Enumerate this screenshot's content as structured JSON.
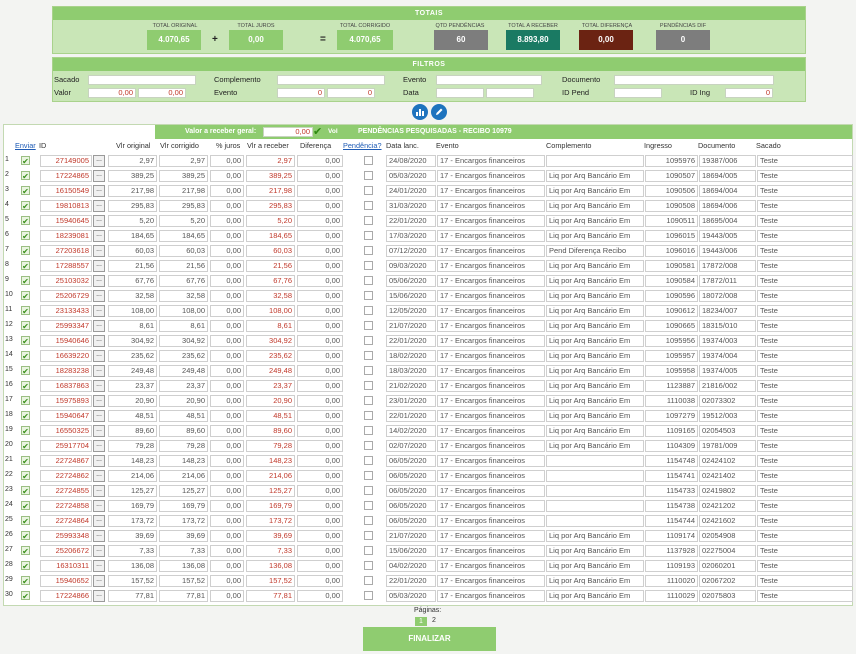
{
  "totals": {
    "title": "TOTAIS",
    "total_original_label": "TOTAL ORIGINAL",
    "total_original": "4.070,65",
    "total_juros_label": "TOTAL JUROS",
    "total_juros": "0,00",
    "total_corrigido_label": "TOTAL CORRIGIDO",
    "total_corrigido": "4.070,65",
    "qtd_pendencias_label": "QTD PENDÊNCIAS",
    "qtd_pendencias": "60",
    "total_receber_label": "TOTAL A RECEBER",
    "total_receber": "8.893,80",
    "total_diferenca_label": "TOTAL DIFERENÇA",
    "total_diferenca": "0,00",
    "pendencias_dif_label": "PENDÊNCIAS DIF",
    "pendencias_dif": "0",
    "plus": "+",
    "equals": "=",
    "colors": {
      "green_box": "#8fcc70",
      "gray_box": "#7d7d7d",
      "teal_box": "#1a7a63",
      "brown_box": "#6b2312"
    }
  },
  "filters": {
    "title": "FILTROS",
    "sacado_label": "Sacado",
    "complemento_label": "Complemento",
    "evento_label": "Evento",
    "documento_label": "Documento",
    "valor_label": "Valor",
    "valor_from": "0,00",
    "valor_to": "0,00",
    "evento2_label": "Evento",
    "evento_from": "0",
    "evento_to": "0",
    "data_label": "Data",
    "id_pend_label": "ID Pend",
    "id_ing_label": "ID Ing",
    "id_ing": "0"
  },
  "actions": {
    "chart_icon": "bar-chart-icon",
    "edit_icon": "pencil-icon"
  },
  "table": {
    "valor_receber_label": "Valor a receber geral:",
    "valor_receber": "0,00",
    "vol_label": "Vol",
    "pendencias_title": "PENDÊNCIAS PESQUISADAS - RECIBO 10979",
    "headers": {
      "enviar": "Enviar",
      "id": "ID",
      "vlr_original": "Vlr original",
      "vlr_corrigido": "Vlr corrigido",
      "juros": "% juros",
      "vlr_receber": "Vlr a receber",
      "diferenca": "Diferença",
      "pendencia": "Pendência?",
      "data_lanc": "Data lanc.",
      "evento": "Evento",
      "complemento": "Complemento",
      "ingresso": "Ingresso",
      "documento": "Documento",
      "sacado": "Sacado"
    },
    "dots_label": "...",
    "rows": [
      {
        "n": "1",
        "id": "27149005",
        "orig": "2,97",
        "corr": "2,97",
        "juros": "0,00",
        "receber": "2,97",
        "dif": "0,00",
        "data": "24/08/2020",
        "evento": "17 - Encargos financeiros",
        "comp": "",
        "ing": "1095976",
        "doc": "19387/006",
        "sacado": "Teste"
      },
      {
        "n": "2",
        "id": "17224865",
        "orig": "389,25",
        "corr": "389,25",
        "juros": "0,00",
        "receber": "389,25",
        "dif": "0,00",
        "data": "05/03/2020",
        "evento": "17 - Encargos financeiros",
        "comp": "Liq por Arq Bancário Em",
        "ing": "1090507",
        "doc": "18694/005",
        "sacado": "Teste"
      },
      {
        "n": "3",
        "id": "16150549",
        "orig": "217,98",
        "corr": "217,98",
        "juros": "0,00",
        "receber": "217,98",
        "dif": "0,00",
        "data": "24/01/2020",
        "evento": "17 - Encargos financeiros",
        "comp": "Liq por Arq Bancário Em",
        "ing": "1090506",
        "doc": "18694/004",
        "sacado": "Teste"
      },
      {
        "n": "4",
        "id": "19810813",
        "orig": "295,83",
        "corr": "295,83",
        "juros": "0,00",
        "receber": "295,83",
        "dif": "0,00",
        "data": "31/03/2020",
        "evento": "17 - Encargos financeiros",
        "comp": "Liq por Arq Bancário Em",
        "ing": "1090508",
        "doc": "18694/006",
        "sacado": "Teste"
      },
      {
        "n": "5",
        "id": "15940645",
        "orig": "5,20",
        "corr": "5,20",
        "juros": "0,00",
        "receber": "5,20",
        "dif": "0,00",
        "data": "22/01/2020",
        "evento": "17 - Encargos financeiros",
        "comp": "Liq por Arq Bancário Em",
        "ing": "1090511",
        "doc": "18695/004",
        "sacado": "Teste"
      },
      {
        "n": "6",
        "id": "18239081",
        "orig": "184,65",
        "corr": "184,65",
        "juros": "0,00",
        "receber": "184,65",
        "dif": "0,00",
        "data": "17/03/2020",
        "evento": "17 - Encargos financeiros",
        "comp": "Liq por Arq Bancário Em",
        "ing": "1096015",
        "doc": "19443/005",
        "sacado": "Teste"
      },
      {
        "n": "7",
        "id": "27203618",
        "orig": "60,03",
        "corr": "60,03",
        "juros": "0,00",
        "receber": "60,03",
        "dif": "0,00",
        "data": "07/12/2020",
        "evento": "17 - Encargos financeiros",
        "comp": "Pend Diferença Recibo",
        "ing": "1096016",
        "doc": "19443/006",
        "sacado": "Teste"
      },
      {
        "n": "8",
        "id": "17288557",
        "orig": "21,56",
        "corr": "21,56",
        "juros": "0,00",
        "receber": "21,56",
        "dif": "0,00",
        "data": "09/03/2020",
        "evento": "17 - Encargos financeiros",
        "comp": "Liq por Arq Bancário Em",
        "ing": "1090581",
        "doc": "17872/008",
        "sacado": "Teste"
      },
      {
        "n": "9",
        "id": "25103032",
        "orig": "67,76",
        "corr": "67,76",
        "juros": "0,00",
        "receber": "67,76",
        "dif": "0,00",
        "data": "05/06/2020",
        "evento": "17 - Encargos financeiros",
        "comp": "Liq por Arq Bancário Em",
        "ing": "1090584",
        "doc": "17872/011",
        "sacado": "Teste"
      },
      {
        "n": "10",
        "id": "25206729",
        "orig": "32,58",
        "corr": "32,58",
        "juros": "0,00",
        "receber": "32,58",
        "dif": "0,00",
        "data": "15/06/2020",
        "evento": "17 - Encargos financeiros",
        "comp": "Liq por Arq Bancário Em",
        "ing": "1090596",
        "doc": "18072/008",
        "sacado": "Teste"
      },
      {
        "n": "11",
        "id": "23133433",
        "orig": "108,00",
        "corr": "108,00",
        "juros": "0,00",
        "receber": "108,00",
        "dif": "0,00",
        "data": "12/05/2020",
        "evento": "17 - Encargos financeiros",
        "comp": "Liq por Arq Bancário Em",
        "ing": "1090612",
        "doc": "18234/007",
        "sacado": "Teste"
      },
      {
        "n": "12",
        "id": "25993347",
        "orig": "8,61",
        "corr": "8,61",
        "juros": "0,00",
        "receber": "8,61",
        "dif": "0,00",
        "data": "21/07/2020",
        "evento": "17 - Encargos financeiros",
        "comp": "Liq por Arq Bancário Em",
        "ing": "1090665",
        "doc": "18315/010",
        "sacado": "Teste"
      },
      {
        "n": "13",
        "id": "15940646",
        "orig": "304,92",
        "corr": "304,92",
        "juros": "0,00",
        "receber": "304,92",
        "dif": "0,00",
        "data": "22/01/2020",
        "evento": "17 - Encargos financeiros",
        "comp": "Liq por Arq Bancário Em",
        "ing": "1095956",
        "doc": "19374/003",
        "sacado": "Teste"
      },
      {
        "n": "14",
        "id": "16639220",
        "orig": "235,62",
        "corr": "235,62",
        "juros": "0,00",
        "receber": "235,62",
        "dif": "0,00",
        "data": "18/02/2020",
        "evento": "17 - Encargos financeiros",
        "comp": "Liq por Arq Bancário Em",
        "ing": "1095957",
        "doc": "19374/004",
        "sacado": "Teste"
      },
      {
        "n": "15",
        "id": "18283238",
        "orig": "249,48",
        "corr": "249,48",
        "juros": "0,00",
        "receber": "249,48",
        "dif": "0,00",
        "data": "18/03/2020",
        "evento": "17 - Encargos financeiros",
        "comp": "Liq por Arq Bancário Em",
        "ing": "1095958",
        "doc": "19374/005",
        "sacado": "Teste"
      },
      {
        "n": "16",
        "id": "16837863",
        "orig": "23,37",
        "corr": "23,37",
        "juros": "0,00",
        "receber": "23,37",
        "dif": "0,00",
        "data": "21/02/2020",
        "evento": "17 - Encargos financeiros",
        "comp": "Liq por Arq Bancário Em",
        "ing": "1123887",
        "doc": "21816/002",
        "sacado": "Teste"
      },
      {
        "n": "17",
        "id": "15975893",
        "orig": "20,90",
        "corr": "20,90",
        "juros": "0,00",
        "receber": "20,90",
        "dif": "0,00",
        "data": "23/01/2020",
        "evento": "17 - Encargos financeiros",
        "comp": "Liq por Arq Bancário Em",
        "ing": "1110038",
        "doc": "02073302",
        "sacado": "Teste"
      },
      {
        "n": "18",
        "id": "15940647",
        "orig": "48,51",
        "corr": "48,51",
        "juros": "0,00",
        "receber": "48,51",
        "dif": "0,00",
        "data": "22/01/2020",
        "evento": "17 - Encargos financeiros",
        "comp": "Liq por Arq Bancário Em",
        "ing": "1097279",
        "doc": "19512/003",
        "sacado": "Teste"
      },
      {
        "n": "19",
        "id": "16550325",
        "orig": "89,60",
        "corr": "89,60",
        "juros": "0,00",
        "receber": "89,60",
        "dif": "0,00",
        "data": "14/02/2020",
        "evento": "17 - Encargos financeiros",
        "comp": "Liq por Arq Bancário Em",
        "ing": "1109165",
        "doc": "02054503",
        "sacado": "Teste"
      },
      {
        "n": "20",
        "id": "25917704",
        "orig": "79,28",
        "corr": "79,28",
        "juros": "0,00",
        "receber": "79,28",
        "dif": "0,00",
        "data": "02/07/2020",
        "evento": "17 - Encargos financeiros",
        "comp": "Liq por Arq Bancário Em",
        "ing": "1104309",
        "doc": "19781/009",
        "sacado": "Teste"
      },
      {
        "n": "21",
        "id": "22724867",
        "orig": "148,23",
        "corr": "148,23",
        "juros": "0,00",
        "receber": "148,23",
        "dif": "0,00",
        "data": "06/05/2020",
        "evento": "17 - Encargos financeiros",
        "comp": "",
        "ing": "1154748",
        "doc": "02424102",
        "sacado": "Teste"
      },
      {
        "n": "22",
        "id": "22724862",
        "orig": "214,06",
        "corr": "214,06",
        "juros": "0,00",
        "receber": "214,06",
        "dif": "0,00",
        "data": "06/05/2020",
        "evento": "17 - Encargos financeiros",
        "comp": "",
        "ing": "1154741",
        "doc": "02421402",
        "sacado": "Teste"
      },
      {
        "n": "23",
        "id": "22724855",
        "orig": "125,27",
        "corr": "125,27",
        "juros": "0,00",
        "receber": "125,27",
        "dif": "0,00",
        "data": "06/05/2020",
        "evento": "17 - Encargos financeiros",
        "comp": "",
        "ing": "1154733",
        "doc": "02419802",
        "sacado": "Teste"
      },
      {
        "n": "24",
        "id": "22724858",
        "orig": "169,79",
        "corr": "169,79",
        "juros": "0,00",
        "receber": "169,79",
        "dif": "0,00",
        "data": "06/05/2020",
        "evento": "17 - Encargos financeiros",
        "comp": "",
        "ing": "1154738",
        "doc": "02421202",
        "sacado": "Teste"
      },
      {
        "n": "25",
        "id": "22724864",
        "orig": "173,72",
        "corr": "173,72",
        "juros": "0,00",
        "receber": "173,72",
        "dif": "0,00",
        "data": "06/05/2020",
        "evento": "17 - Encargos financeiros",
        "comp": "",
        "ing": "1154744",
        "doc": "02421602",
        "sacado": "Teste"
      },
      {
        "n": "26",
        "id": "25993348",
        "orig": "39,69",
        "corr": "39,69",
        "juros": "0,00",
        "receber": "39,69",
        "dif": "0,00",
        "data": "21/07/2020",
        "evento": "17 - Encargos financeiros",
        "comp": "Liq por Arq Bancário Em",
        "ing": "1109174",
        "doc": "02054908",
        "sacado": "Teste"
      },
      {
        "n": "27",
        "id": "25206672",
        "orig": "7,33",
        "corr": "7,33",
        "juros": "0,00",
        "receber": "7,33",
        "dif": "0,00",
        "data": "15/06/2020",
        "evento": "17 - Encargos financeiros",
        "comp": "Liq por Arq Bancário Em",
        "ing": "1137928",
        "doc": "02275004",
        "sacado": "Teste"
      },
      {
        "n": "28",
        "id": "16310311",
        "orig": "136,08",
        "corr": "136,08",
        "juros": "0,00",
        "receber": "136,08",
        "dif": "0,00",
        "data": "04/02/2020",
        "evento": "17 - Encargos financeiros",
        "comp": "Liq por Arq Bancário Em",
        "ing": "1109193",
        "doc": "02060201",
        "sacado": "Teste"
      },
      {
        "n": "29",
        "id": "15940652",
        "orig": "157,52",
        "corr": "157,52",
        "juros": "0,00",
        "receber": "157,52",
        "dif": "0,00",
        "data": "22/01/2020",
        "evento": "17 - Encargos financeiros",
        "comp": "Liq por Arq Bancário Em",
        "ing": "1110020",
        "doc": "02067202",
        "sacado": "Teste"
      },
      {
        "n": "30",
        "id": "17224866",
        "orig": "77,81",
        "corr": "77,81",
        "juros": "0,00",
        "receber": "77,81",
        "dif": "0,00",
        "data": "05/03/2020",
        "evento": "17 - Encargos financeiros",
        "comp": "Liq por Arq Bancário Em",
        "ing": "1110029",
        "doc": "02075803",
        "sacado": "Teste"
      }
    ]
  },
  "pagination": {
    "label": "Páginas:",
    "pages": [
      "1",
      "2"
    ],
    "current": "1"
  },
  "finalizar_label": "FINALIZAR"
}
